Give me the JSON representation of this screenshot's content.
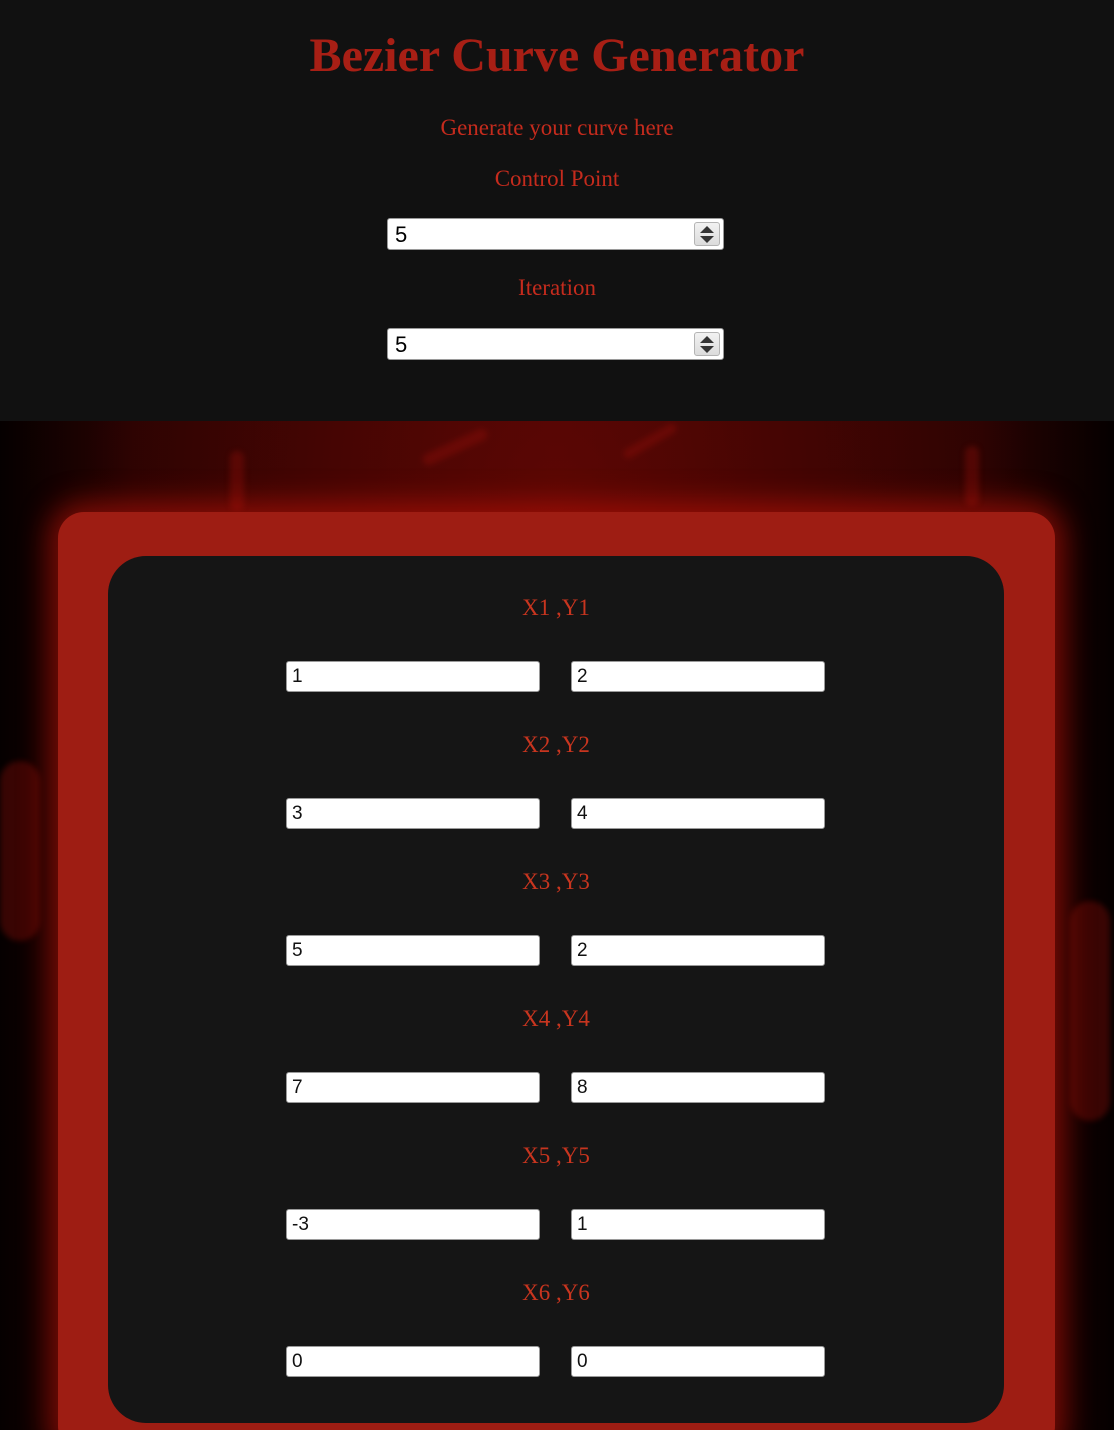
{
  "header": {
    "title": "Bezier Curve Generator",
    "subtitle": "Generate your curve here"
  },
  "control_point": {
    "label": "Control Point",
    "value": "5"
  },
  "iteration": {
    "label": "Iteration",
    "value": "5"
  },
  "points": [
    {
      "label": "X1 ,Y1",
      "x": "1",
      "y": "2"
    },
    {
      "label": "X2 ,Y2",
      "x": "3",
      "y": "4"
    },
    {
      "label": "X3 ,Y3",
      "x": "5",
      "y": "2"
    },
    {
      "label": "X4 ,Y4",
      "x": "7",
      "y": "8"
    },
    {
      "label": "X5 ,Y5",
      "x": "-3",
      "y": "1"
    },
    {
      "label": "X6 ,Y6",
      "x": "0",
      "y": "0"
    }
  ],
  "colors": {
    "title": "#a81f15",
    "label": "#c52b1d",
    "panel_red": "#9e1d13",
    "card_dark": "#151515",
    "header_bg": "#111111"
  }
}
